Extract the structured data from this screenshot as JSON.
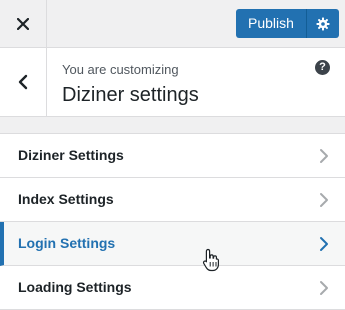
{
  "topbar": {
    "close_icon": "close-icon",
    "publish_label": "Publish",
    "settings_icon": "gear-icon"
  },
  "header": {
    "back_icon": "chevron-left-icon",
    "customizing_label": "You are customizing",
    "site_title": "Diziner settings",
    "help_icon_glyph": "?"
  },
  "menu": {
    "items": [
      {
        "label": "Diziner Settings"
      },
      {
        "label": "Index Settings"
      },
      {
        "label": "Login Settings"
      },
      {
        "label": "Loading Settings"
      }
    ],
    "active_index": 2
  },
  "colors": {
    "accent": "#2271b1",
    "background": "#f0f0f1"
  }
}
